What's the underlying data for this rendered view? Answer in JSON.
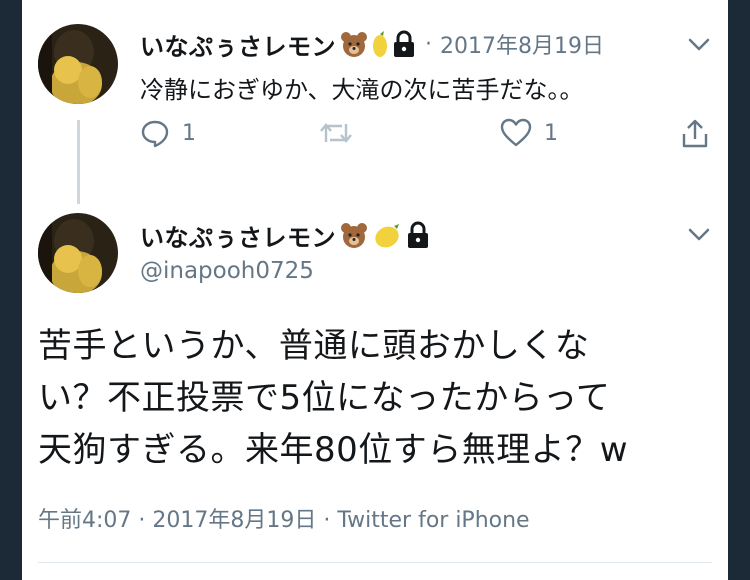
{
  "reply_tweet": {
    "display_name": "いなぷぅさレモン",
    "badges": [
      "bear-face-icon",
      "lemon-icon",
      "lock-icon"
    ],
    "separator": "·",
    "date": "2017年8月19日",
    "text": "冷静におぎゆか、大滝の次に苦手だな。。",
    "actions": {
      "reply_count": "1",
      "retweet_count": "",
      "like_count": "1"
    }
  },
  "main_tweet": {
    "display_name": "いなぷぅさレモン",
    "badges": [
      "bear-face-icon",
      "lemon-icon",
      "lock-icon"
    ],
    "handle": "@inapooh0725",
    "text_lines": [
      "苦手というか、普通に頭おかしくな",
      "い？不正投票で5位になったからって",
      "天狗すぎる。来年80位すら無理よ？w"
    ],
    "footer": "午前4:07 · 2017年8月19日 · Twitter for iPhone"
  },
  "colors": {
    "text": "#14171a",
    "secondary": "#657786",
    "background_outer": "#1c2a38",
    "card": "#ffffff",
    "thread_line": "#cfd6dc"
  }
}
